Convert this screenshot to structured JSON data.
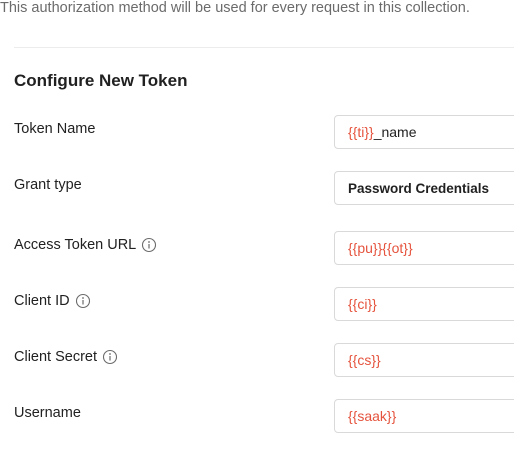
{
  "header": {
    "note": "This authorization method will be used for every request in this collection."
  },
  "section": {
    "title": "Configure New Token"
  },
  "fields": {
    "token_name": {
      "label": "Token Name",
      "var": "{{ti}}",
      "suffix": "_name"
    },
    "grant_type": {
      "label": "Grant type",
      "value": "Password Credentials"
    },
    "access_token_url": {
      "label": "Access Token URL",
      "value": "{{pu}}{{ot}}"
    },
    "client_id": {
      "label": "Client ID",
      "value": "{{ci}}"
    },
    "client_secret": {
      "label": "Client Secret",
      "value": "{{cs}}"
    },
    "username": {
      "label": "Username",
      "value": "{{saak}}"
    }
  },
  "icons": {
    "info": "info-circle-icon"
  },
  "colors": {
    "variable": "#e5533d",
    "text": "#212121",
    "muted": "#6b6b6b",
    "border": "#d9d9d9"
  }
}
